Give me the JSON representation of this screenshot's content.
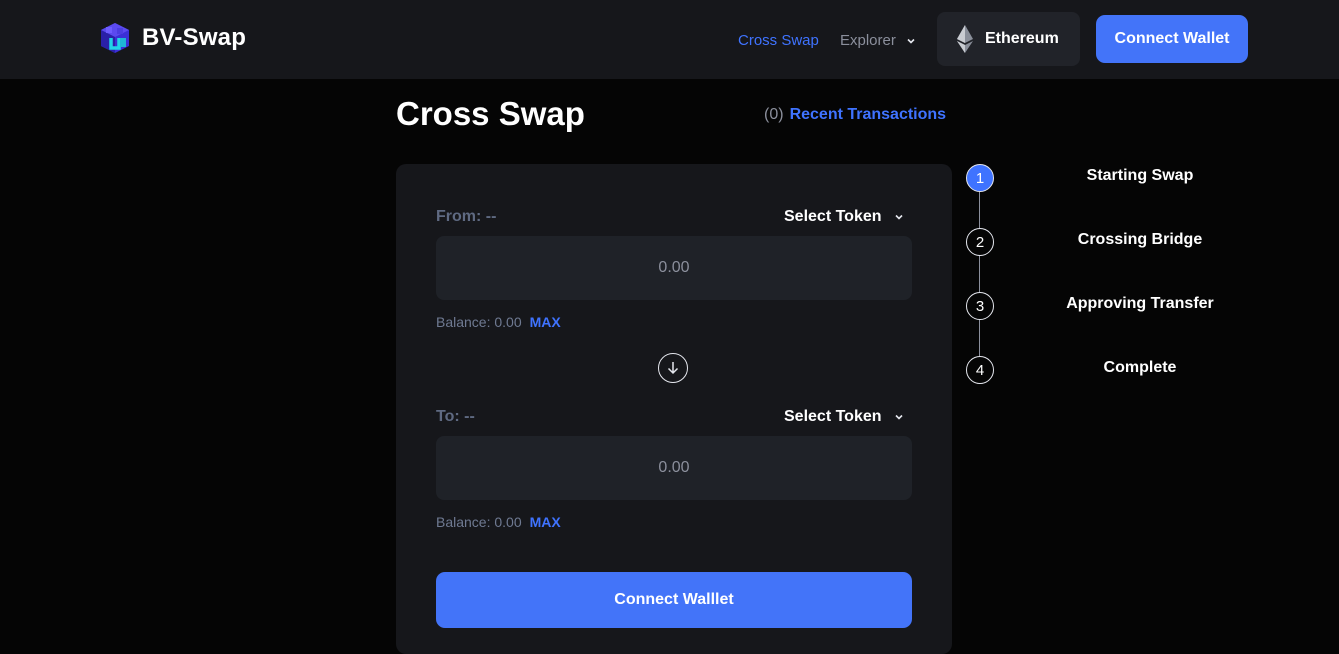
{
  "header": {
    "brand": "BV-Swap",
    "nav": {
      "cross_swap": "Cross Swap",
      "explorer": "Explorer"
    },
    "network": "Ethereum",
    "connect_wallet": "Connect Wallet"
  },
  "main": {
    "title": "Cross Swap",
    "recent_count": "(0)",
    "recent_label": "Recent Transactions",
    "from": {
      "label": "From: --",
      "select_token": "Select Token",
      "amount": "0.00",
      "balance": "Balance: 0.00",
      "max": "MAX"
    },
    "to": {
      "label": "To: --",
      "select_token": "Select Token",
      "amount": "0.00",
      "balance": "Balance: 0.00",
      "max": "MAX"
    },
    "connect_button": "Connect Walllet"
  },
  "steps": [
    {
      "num": "1",
      "label": "Starting Swap"
    },
    {
      "num": "2",
      "label": "Crossing Bridge"
    },
    {
      "num": "3",
      "label": "Approving Transfer"
    },
    {
      "num": "4",
      "label": "Complete"
    }
  ],
  "colors": {
    "accent": "#4374f9",
    "link": "#3f73ff",
    "background": "#050505",
    "panel": "#16171b"
  }
}
